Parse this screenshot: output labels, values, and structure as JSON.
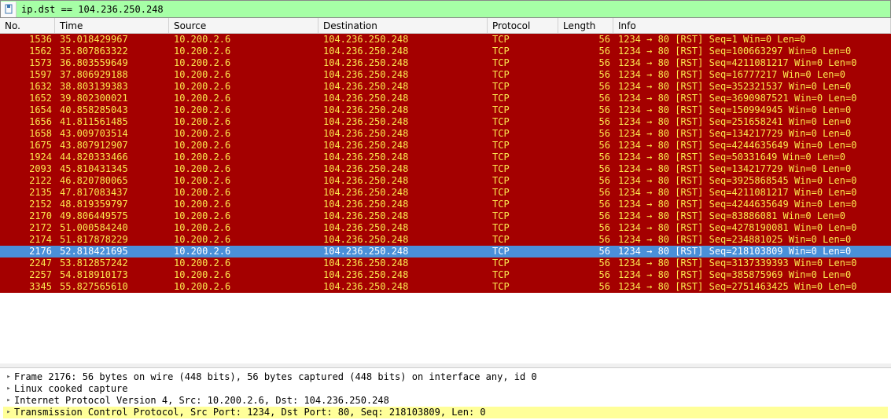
{
  "filter": {
    "value": "ip.dst == 104.236.250.248"
  },
  "columns": {
    "no": "No.",
    "time": "Time",
    "source": "Source",
    "destination": "Destination",
    "protocol": "Protocol",
    "length": "Length",
    "info": "Info"
  },
  "packets": [
    {
      "no": "1536",
      "time": "35.018429967",
      "src": "10.200.2.6",
      "dst": "104.236.250.248",
      "proto": "TCP",
      "len": "56",
      "info": "1234 → 80 [RST] Seq=1 Win=0 Len=0",
      "sel": false
    },
    {
      "no": "1562",
      "time": "35.807863322",
      "src": "10.200.2.6",
      "dst": "104.236.250.248",
      "proto": "TCP",
      "len": "56",
      "info": "1234 → 80 [RST] Seq=100663297 Win=0 Len=0",
      "sel": false
    },
    {
      "no": "1573",
      "time": "36.803559649",
      "src": "10.200.2.6",
      "dst": "104.236.250.248",
      "proto": "TCP",
      "len": "56",
      "info": "1234 → 80 [RST] Seq=4211081217 Win=0 Len=0",
      "sel": false
    },
    {
      "no": "1597",
      "time": "37.806929188",
      "src": "10.200.2.6",
      "dst": "104.236.250.248",
      "proto": "TCP",
      "len": "56",
      "info": "1234 → 80 [RST] Seq=16777217 Win=0 Len=0",
      "sel": false
    },
    {
      "no": "1632",
      "time": "38.803139383",
      "src": "10.200.2.6",
      "dst": "104.236.250.248",
      "proto": "TCP",
      "len": "56",
      "info": "1234 → 80 [RST] Seq=352321537 Win=0 Len=0",
      "sel": false
    },
    {
      "no": "1652",
      "time": "39.802300021",
      "src": "10.200.2.6",
      "dst": "104.236.250.248",
      "proto": "TCP",
      "len": "56",
      "info": "1234 → 80 [RST] Seq=3690987521 Win=0 Len=0",
      "sel": false
    },
    {
      "no": "1654",
      "time": "40.858285043",
      "src": "10.200.2.6",
      "dst": "104.236.250.248",
      "proto": "TCP",
      "len": "56",
      "info": "1234 → 80 [RST] Seq=150994945 Win=0 Len=0",
      "sel": false
    },
    {
      "no": "1656",
      "time": "41.811561485",
      "src": "10.200.2.6",
      "dst": "104.236.250.248",
      "proto": "TCP",
      "len": "56",
      "info": "1234 → 80 [RST] Seq=251658241 Win=0 Len=0",
      "sel": false
    },
    {
      "no": "1658",
      "time": "43.009703514",
      "src": "10.200.2.6",
      "dst": "104.236.250.248",
      "proto": "TCP",
      "len": "56",
      "info": "1234 → 80 [RST] Seq=134217729 Win=0 Len=0",
      "sel": false
    },
    {
      "no": "1675",
      "time": "43.807912907",
      "src": "10.200.2.6",
      "dst": "104.236.250.248",
      "proto": "TCP",
      "len": "56",
      "info": "1234 → 80 [RST] Seq=4244635649 Win=0 Len=0",
      "sel": false
    },
    {
      "no": "1924",
      "time": "44.820333466",
      "src": "10.200.2.6",
      "dst": "104.236.250.248",
      "proto": "TCP",
      "len": "56",
      "info": "1234 → 80 [RST] Seq=50331649 Win=0 Len=0",
      "sel": false
    },
    {
      "no": "2093",
      "time": "45.810431345",
      "src": "10.200.2.6",
      "dst": "104.236.250.248",
      "proto": "TCP",
      "len": "56",
      "info": "1234 → 80 [RST] Seq=134217729 Win=0 Len=0",
      "sel": false
    },
    {
      "no": "2122",
      "time": "46.820780065",
      "src": "10.200.2.6",
      "dst": "104.236.250.248",
      "proto": "TCP",
      "len": "56",
      "info": "1234 → 80 [RST] Seq=3925868545 Win=0 Len=0",
      "sel": false
    },
    {
      "no": "2135",
      "time": "47.817083437",
      "src": "10.200.2.6",
      "dst": "104.236.250.248",
      "proto": "TCP",
      "len": "56",
      "info": "1234 → 80 [RST] Seq=4211081217 Win=0 Len=0",
      "sel": false
    },
    {
      "no": "2152",
      "time": "48.819359797",
      "src": "10.200.2.6",
      "dst": "104.236.250.248",
      "proto": "TCP",
      "len": "56",
      "info": "1234 → 80 [RST] Seq=4244635649 Win=0 Len=0",
      "sel": false
    },
    {
      "no": "2170",
      "time": "49.806449575",
      "src": "10.200.2.6",
      "dst": "104.236.250.248",
      "proto": "TCP",
      "len": "56",
      "info": "1234 → 80 [RST] Seq=83886081 Win=0 Len=0",
      "sel": false
    },
    {
      "no": "2172",
      "time": "51.000584240",
      "src": "10.200.2.6",
      "dst": "104.236.250.248",
      "proto": "TCP",
      "len": "56",
      "info": "1234 → 80 [RST] Seq=4278190081 Win=0 Len=0",
      "sel": false
    },
    {
      "no": "2174",
      "time": "51.817878229",
      "src": "10.200.2.6",
      "dst": "104.236.250.248",
      "proto": "TCP",
      "len": "56",
      "info": "1234 → 80 [RST] Seq=234881025 Win=0 Len=0",
      "sel": false
    },
    {
      "no": "2176",
      "time": "52.818421695",
      "src": "10.200.2.6",
      "dst": "104.236.250.248",
      "proto": "TCP",
      "len": "56",
      "info": "1234 → 80 [RST] Seq=218103809 Win=0 Len=0",
      "sel": true
    },
    {
      "no": "2247",
      "time": "53.812857242",
      "src": "10.200.2.6",
      "dst": "104.236.250.248",
      "proto": "TCP",
      "len": "56",
      "info": "1234 → 80 [RST] Seq=3137339393 Win=0 Len=0",
      "sel": false
    },
    {
      "no": "2257",
      "time": "54.818910173",
      "src": "10.200.2.6",
      "dst": "104.236.250.248",
      "proto": "TCP",
      "len": "56",
      "info": "1234 → 80 [RST] Seq=385875969 Win=0 Len=0",
      "sel": false
    },
    {
      "no": "3345",
      "time": "55.827565610",
      "src": "10.200.2.6",
      "dst": "104.236.250.248",
      "proto": "TCP",
      "len": "56",
      "info": "1234 → 80 [RST] Seq=2751463425 Win=0 Len=0",
      "sel": false
    }
  ],
  "details": {
    "lines": [
      {
        "text": "Frame 2176: 56 bytes on wire (448 bits), 56 bytes captured (448 bits) on interface any, id 0",
        "hl": false
      },
      {
        "text": "Linux cooked capture",
        "hl": false
      },
      {
        "text": "Internet Protocol Version 4, Src: 10.200.2.6, Dst: 104.236.250.248",
        "hl": false
      },
      {
        "text": "Transmission Control Protocol, Src Port: 1234, Dst Port: 80, Seq: 218103809, Len: 0",
        "hl": true
      }
    ]
  }
}
